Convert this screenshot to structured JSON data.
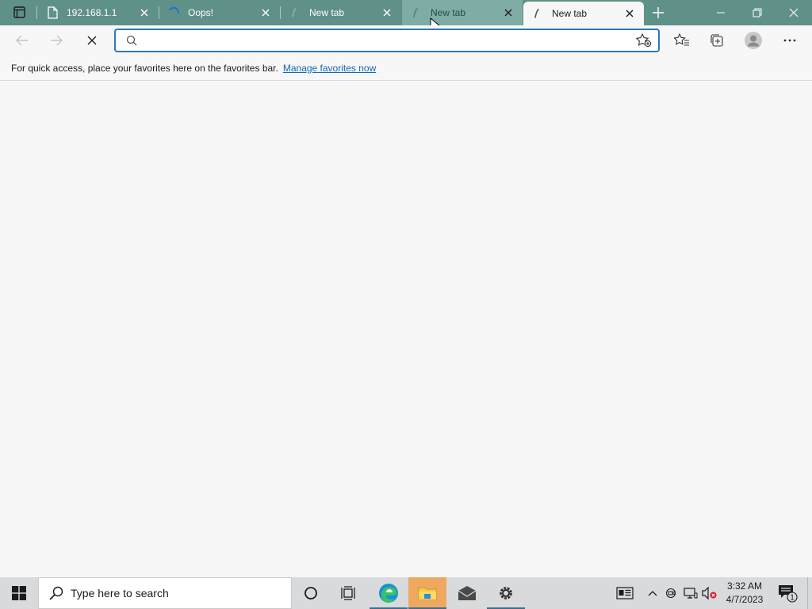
{
  "browser": {
    "tabs": [
      {
        "title": "192.168.1.1",
        "icon": "page-icon",
        "state": "normal"
      },
      {
        "title": "Oops!",
        "icon": "loading-spinner-icon",
        "state": "normal"
      },
      {
        "title": "New tab",
        "icon": "loading-icon",
        "state": "normal"
      },
      {
        "title": "New tab",
        "icon": "loading-icon",
        "state": "hover"
      },
      {
        "title": "New tab",
        "icon": "loading-icon",
        "state": "active"
      }
    ],
    "address_bar": {
      "value": "",
      "placeholder": ""
    },
    "favorites_bar": {
      "message": "For quick access, place your favorites here on the favorites bar.",
      "link": "Manage favorites now"
    },
    "colors": {
      "tab_strip": "#5f9188",
      "hover_tab": "#7fada5",
      "page_background": "#f7f7f7",
      "address_focus": "#2b79b8",
      "link": "#1366b3"
    }
  },
  "taskbar": {
    "search_placeholder": "Type here to search",
    "clock": {
      "time": "3:32 AM",
      "date": "4/7/2023"
    },
    "notification_count": "1",
    "pinned_apps": [
      "cortana-icon",
      "task-view-icon",
      "edge-icon",
      "file-explorer-icon",
      "mail-icon",
      "settings-icon"
    ],
    "colors": {
      "taskbar": "#d9dadc",
      "highlight": "#f0a860"
    }
  }
}
